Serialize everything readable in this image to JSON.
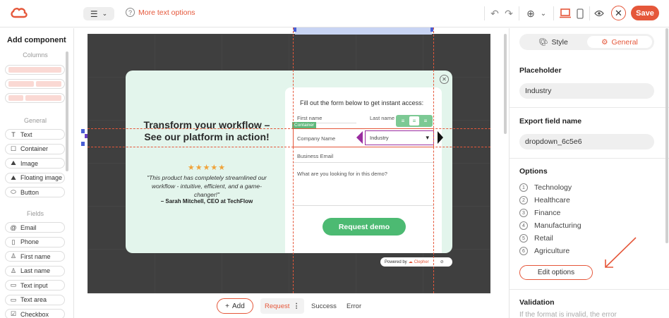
{
  "colors": {
    "accent": "#e5573a",
    "canvas": "#3f3f3f",
    "popup_bg": "#e3f5ec",
    "cta": "#4cba72",
    "selection": "#9a2ca0"
  },
  "topbar": {
    "logo": "clepher-logo-icon",
    "align_icon": "align-left-icon",
    "more_text_options": "More text options",
    "save_label": "Save"
  },
  "left": {
    "title": "Add component",
    "columns_label": "Columns",
    "general_label": "General",
    "fields_label": "Fields",
    "general_items": [
      {
        "label": "Text",
        "icon": "T"
      },
      {
        "label": "Container",
        "icon": "☐"
      },
      {
        "label": "Image",
        "icon": "⛰"
      },
      {
        "label": "Floating image",
        "icon": "⛰"
      },
      {
        "label": "Button",
        "icon": "⬭"
      }
    ],
    "field_items": [
      {
        "label": "Email",
        "icon": "@"
      },
      {
        "label": "Phone",
        "icon": "▯"
      },
      {
        "label": "First name",
        "icon": "♙"
      },
      {
        "label": "Last name",
        "icon": "♙"
      },
      {
        "label": "Text input",
        "icon": "▭"
      },
      {
        "label": "Text area",
        "icon": "▭"
      },
      {
        "label": "Checkbox",
        "icon": "☑"
      }
    ]
  },
  "popup": {
    "headline": "Transform your workflow – See our platform in action!",
    "stars": "★★★★★",
    "quote": "\"This product has completely streamlined our workflow - intuitive, efficient, and a game-changer!\"",
    "author": "– Sarah Mitchell, CEO at TechFlow",
    "form_title": "Fill out the form below to get instant access:",
    "first_name": "First name",
    "last_name": "Last name",
    "container_tag": "Container",
    "company_name": "Company Name",
    "dropdown_value": "Industry",
    "business_email": "Business Email",
    "looking_for": "What are you looking for in this demo?",
    "cta": "Request demo",
    "powered_by": "Powered by",
    "powered_brand": "Clepher"
  },
  "bottom": {
    "add_label": "Add",
    "states": [
      "Request",
      "Success",
      "Error"
    ],
    "active_state": "Request"
  },
  "right": {
    "tab_style": "Style",
    "tab_general": "General",
    "placeholder_label": "Placeholder",
    "placeholder_value": "Industry",
    "export_label": "Export field name",
    "export_value": "dropdown_6c5e6",
    "options_label": "Options",
    "options": [
      {
        "num": "1",
        "label": "Technology"
      },
      {
        "num": "2",
        "label": "Healthcare"
      },
      {
        "num": "3",
        "label": "Finance"
      },
      {
        "num": "4",
        "label": "Manufacturing"
      },
      {
        "num": "5",
        "label": "Retail"
      },
      {
        "num": "6",
        "label": "Agriculture"
      }
    ],
    "edit_options": "Edit options",
    "validation_label": "Validation",
    "validation_help": "If the format is invalid, the error"
  }
}
